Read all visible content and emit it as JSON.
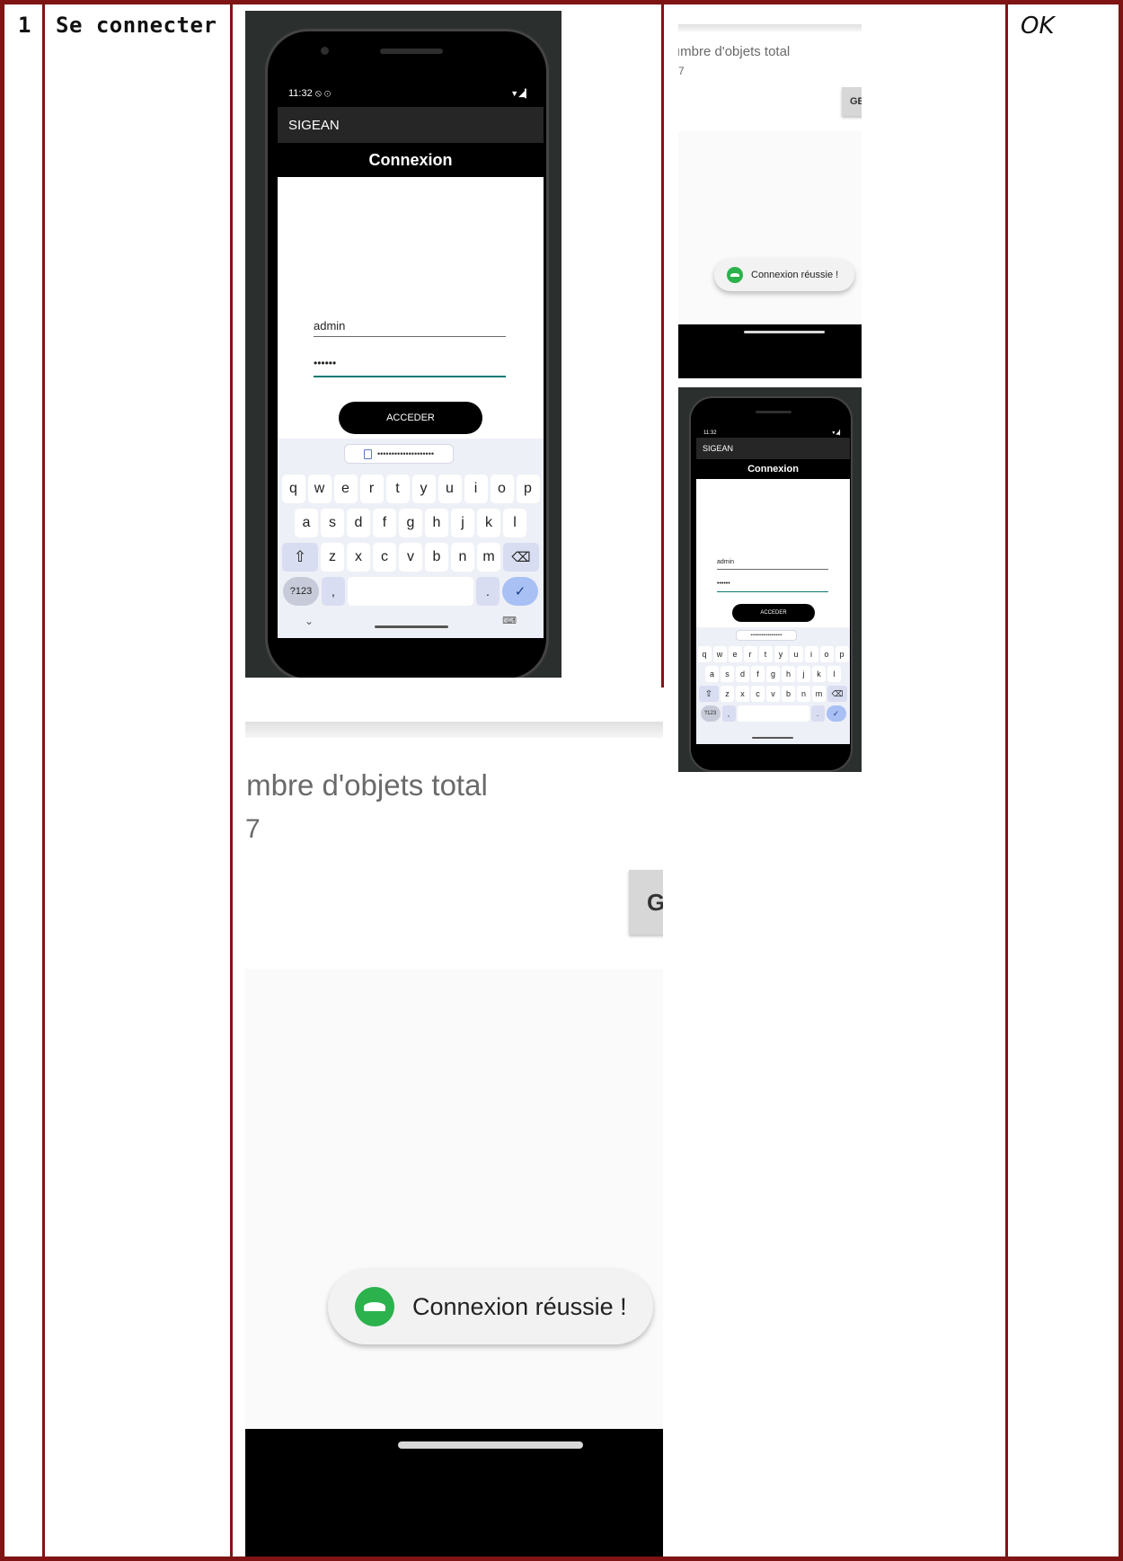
{
  "row": {
    "number": "1",
    "title": "Se connecter",
    "result": "OK"
  },
  "emulator": {
    "status_time": "11:32",
    "status_icons": "⦸ ⊙",
    "status_right": "▼◢▎",
    "app_name": "SIGEAN",
    "screen_title": "Connexion",
    "username_value": "admin",
    "password_value": "••••••",
    "login_button": "ACCEDER",
    "suggestion": "••••••••••••••••••••",
    "keyboard": {
      "row1": [
        "q",
        "w",
        "e",
        "r",
        "t",
        "y",
        "u",
        "i",
        "o",
        "p"
      ],
      "row2": [
        "a",
        "s",
        "d",
        "f",
        "g",
        "h",
        "j",
        "k",
        "l"
      ],
      "row3": [
        "z",
        "x",
        "c",
        "v",
        "b",
        "n",
        "m"
      ],
      "shift": "⇧",
      "backspace": "⌫",
      "symbols": "?123",
      "comma": ",",
      "period": ".",
      "enter": "✓",
      "hide": "⌄",
      "switch": "⌨"
    }
  },
  "result_screen": {
    "label": "ımbre d'objets total",
    "count": "7",
    "button_fragment": "G",
    "button_fragment_small": "GE",
    "toast": "Connexion réussie !"
  },
  "colors": {
    "table_border": "#7f1414",
    "toast_icon": "#2bb24c",
    "password_underline": "#0d7a72"
  }
}
